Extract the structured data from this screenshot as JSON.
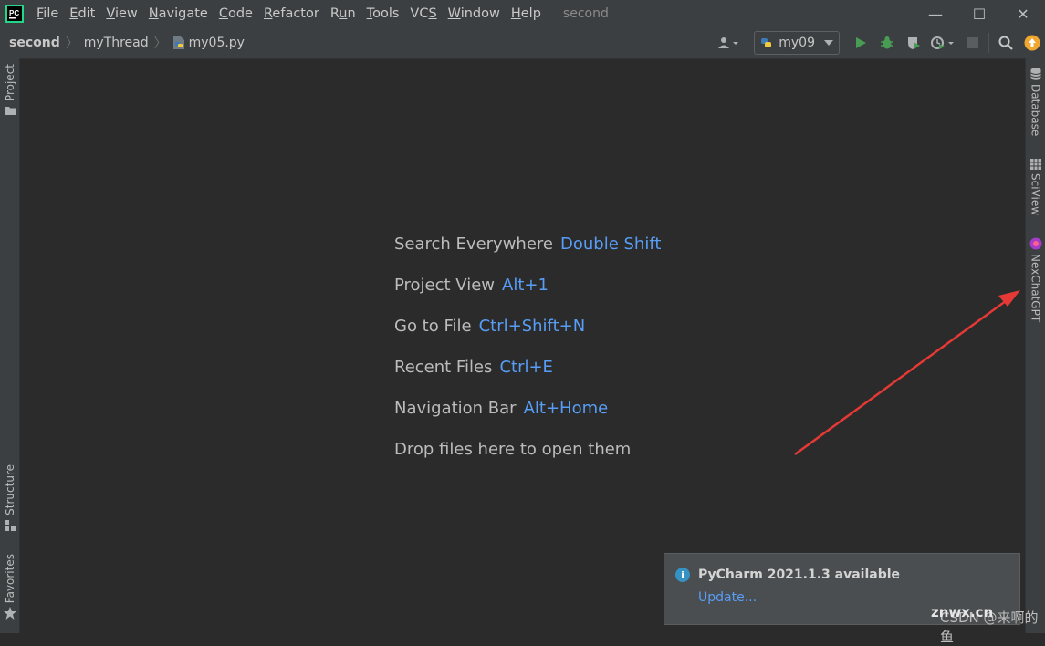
{
  "menu": {
    "items": [
      {
        "pre": "",
        "u": "F",
        "post": "ile"
      },
      {
        "pre": "",
        "u": "E",
        "post": "dit"
      },
      {
        "pre": "",
        "u": "V",
        "post": "iew"
      },
      {
        "pre": "",
        "u": "N",
        "post": "avigate"
      },
      {
        "pre": "",
        "u": "C",
        "post": "ode"
      },
      {
        "pre": "",
        "u": "R",
        "post": "efactor"
      },
      {
        "pre": "R",
        "u": "u",
        "post": "n"
      },
      {
        "pre": "",
        "u": "T",
        "post": "ools"
      },
      {
        "pre": "VC",
        "u": "S",
        "post": ""
      },
      {
        "pre": "",
        "u": "W",
        "post": "indow"
      },
      {
        "pre": "",
        "u": "H",
        "post": "elp"
      }
    ],
    "window_title": "second"
  },
  "window_controls": {
    "minimize": "—",
    "maximize": "☐",
    "close": "✕"
  },
  "breadcrumb": {
    "project": "second",
    "folder": "myThread",
    "file": "my05.py"
  },
  "toolbar": {
    "run_config": "my09"
  },
  "left_tabs": {
    "project": "Project",
    "structure": "Structure",
    "favorites": "Favorites"
  },
  "right_tabs": {
    "database": "Database",
    "sciview": "SciView",
    "nexchat": "NexChatGPT"
  },
  "hints": [
    {
      "label": "Search Everywhere",
      "key": "Double Shift"
    },
    {
      "label": "Project View",
      "key": "Alt+1"
    },
    {
      "label": "Go to File",
      "key": "Ctrl+Shift+N"
    },
    {
      "label": "Recent Files",
      "key": "Ctrl+E"
    },
    {
      "label": "Navigation Bar",
      "key": "Alt+Home"
    },
    {
      "label": "Drop files here to open them",
      "key": ""
    }
  ],
  "notification": {
    "title": "PyCharm 2021.1.3 available",
    "link": "Update..."
  },
  "watermark": {
    "main": "znwx.cn",
    "sub": "CSDN @来啊的鱼"
  },
  "colors": {
    "accent": "#589df6",
    "run_green": "#499c54",
    "arrow_red": "#e53935"
  }
}
